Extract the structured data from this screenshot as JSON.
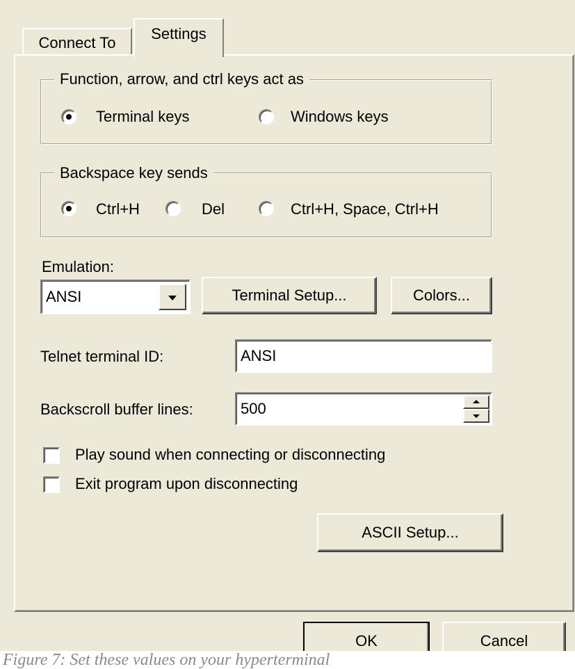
{
  "tabs": {
    "connect_to": "Connect To",
    "settings": "Settings"
  },
  "function_keys": {
    "legend": "Function, arrow, and ctrl keys act as",
    "terminal_keys": "Terminal keys",
    "windows_keys": "Windows keys",
    "selected": "Terminal keys"
  },
  "backspace": {
    "legend": "Backspace key sends",
    "ctrl_h": "Ctrl+H",
    "del": "Del",
    "ctrl_h_space": "Ctrl+H, Space, Ctrl+H",
    "selected": "Ctrl+H"
  },
  "emulation": {
    "label": "Emulation:",
    "value": "ANSI",
    "terminal_setup": "Terminal Setup...",
    "colors": "Colors..."
  },
  "telnet": {
    "label": "Telnet terminal ID:",
    "value": "ANSI"
  },
  "backscroll": {
    "label": "Backscroll buffer lines:",
    "value": "500"
  },
  "options": {
    "play_sound": "Play sound when connecting or disconnecting",
    "play_sound_checked": false,
    "exit_program": "Exit program upon disconnecting",
    "exit_program_checked": false
  },
  "ascii_setup": "ASCII Setup...",
  "dialog_buttons": {
    "ok": "OK",
    "cancel": "Cancel"
  },
  "caption": "Figure 7: Set these values on your hyperterminal"
}
